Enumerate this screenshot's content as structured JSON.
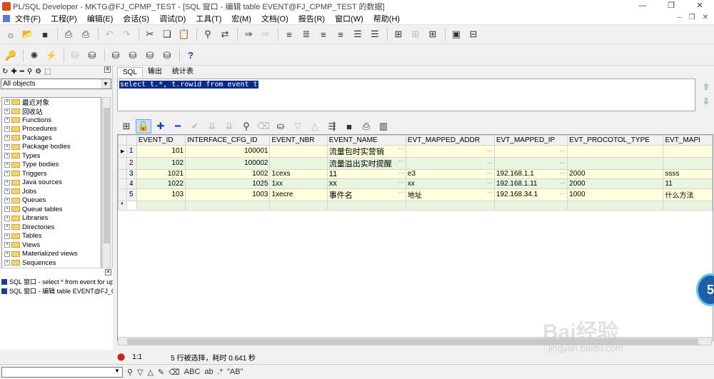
{
  "window": {
    "title": "PL/SQL Developer - MKTG@FJ_CPMP_TEST - [SQL 窗口 - 编辑 table EVENT@FJ_CPMP_TEST 的数据]"
  },
  "menu": [
    "文件(F)",
    "工程(P)",
    "编辑(E)",
    "会话(S)",
    "调试(D)",
    "工具(T)",
    "宏(M)",
    "文档(O)",
    "报告(R)",
    "窗口(W)",
    "帮助(H)"
  ],
  "object_browser": {
    "filter": "All objects",
    "items": [
      "最近对象",
      "回收站",
      "Functions",
      "Procedures",
      "Packages",
      "Package bodies",
      "Types",
      "Type bodies",
      "Triggers",
      "Java sources",
      "Jobs",
      "Queues",
      "Queue tables",
      "Libraries",
      "Directories",
      "Tables",
      "Views",
      "Materialized views",
      "Sequences"
    ]
  },
  "windows_list": [
    "SQL 窗口 - select * from event for upd",
    "SQL 窗口 - 编辑 table EVENT@FJ_C"
  ],
  "tabs": [
    "SQL",
    "输出",
    "统计表"
  ],
  "sql_text": "select t.*, t.rowid from event t",
  "grid": {
    "columns": [
      "EVENT_ID",
      "INTERFACE_CFG_ID",
      "EVENT_NBR",
      "EVENT_NAME",
      "EVT_MAPPED_ADDR",
      "EVT_MAPPED_IP",
      "EVT_PROCOTOL_TYPE",
      "EVT_MAPI"
    ],
    "rows": [
      {
        "n": "1",
        "cells": [
          "101",
          "100001",
          "",
          "流量包时实营销",
          "",
          "",
          "",
          ""
        ]
      },
      {
        "n": "2",
        "cells": [
          "102",
          "100002",
          "",
          "流量溢出实时提醒",
          "",
          "",
          "",
          ""
        ]
      },
      {
        "n": "3",
        "cells": [
          "1021",
          "1002",
          "1cexs",
          "11",
          "e3",
          "192.168.1.1",
          "2000",
          "ssss"
        ]
      },
      {
        "n": "4",
        "cells": [
          "1022",
          "1025",
          "1xx",
          "xx",
          "xx",
          "192.168.1.11",
          "2000",
          "11"
        ]
      },
      {
        "n": "5",
        "cells": [
          "103",
          "1003",
          "1xecre",
          "事件名",
          "地址",
          "192.168.34.1",
          "1000",
          "什么方法"
        ]
      }
    ],
    "new_row_marker": "*"
  },
  "status": {
    "position": "1:1",
    "message": "5 行被选择，耗时 0.641 秒"
  },
  "watermark": {
    "brand": "Bai经验",
    "url": "jingyan.baidu.com"
  },
  "badge": "5"
}
